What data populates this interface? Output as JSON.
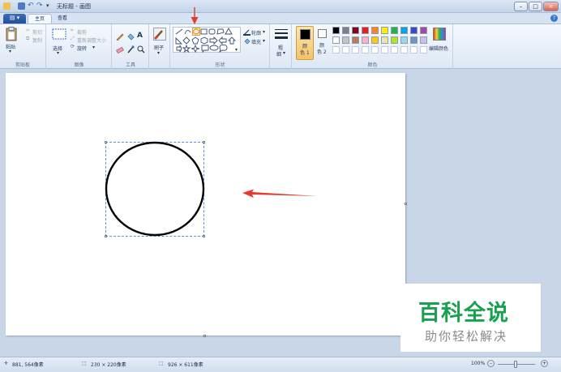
{
  "titlebar": {
    "title": "无标题 - 画图",
    "window_buttons": [
      "minimize",
      "maximize",
      "close"
    ]
  },
  "tabs": {
    "file_label": "",
    "items": [
      {
        "label": "主页",
        "active": true
      },
      {
        "label": "查看",
        "active": false
      }
    ]
  },
  "ribbon": {
    "clipboard": {
      "paste": "粘贴",
      "cut": "剪切",
      "copy": "复制",
      "group": "剪贴板"
    },
    "image": {
      "select": "选择",
      "crop": "裁剪",
      "resize": "重新调整大小",
      "rotate": "旋转",
      "group": "图像"
    },
    "tools": {
      "group": "工具",
      "brush": "刷子"
    },
    "shapes": {
      "outline": "轮廓",
      "fill": "填充",
      "group": "形状",
      "selected_shape": "oval"
    },
    "size": {
      "label_line1": "粗",
      "label_line2": "细"
    },
    "colors": {
      "color1_line1": "颜",
      "color1_line2": "色 1",
      "color2_line1": "颜",
      "color2_line2": "色 2",
      "color1_value": "#000000",
      "color2_value": "#ffffff",
      "edit_colors": "编辑颜色",
      "group": "颜色",
      "palette_row1": [
        "#000000",
        "#7f7f7f",
        "#880015",
        "#ed1c24",
        "#ff7f27",
        "#fff200",
        "#22b14c",
        "#00a2e8",
        "#3f48cc",
        "#a349a4"
      ],
      "palette_row2": [
        "#ffffff",
        "#c3c3c3",
        "#b97a57",
        "#ffaec9",
        "#ffc90e",
        "#efe4b0",
        "#b5e61d",
        "#99d9ea",
        "#7092be",
        "#c8bfe7"
      ]
    }
  },
  "statusbar": {
    "cursor_pos": "881, 564像素",
    "selection_size": "230 × 220像素",
    "image_size": "926 × 611像素",
    "zoom": "100%"
  },
  "watermark": {
    "title": "百科全说",
    "subtitle": "助你轻松解决"
  },
  "annotations": {
    "arrow_color": "#e23b2e"
  }
}
